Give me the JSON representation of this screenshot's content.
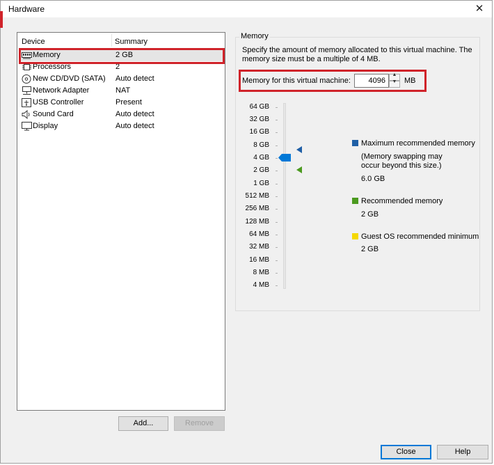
{
  "window": {
    "title": "Hardware",
    "close_glyph": "✕"
  },
  "devices": {
    "col_device": "Device",
    "col_summary": "Summary",
    "items": [
      {
        "name": "Memory",
        "summary": "2 GB",
        "icon": "memory-icon"
      },
      {
        "name": "Processors",
        "summary": "2",
        "icon": "processor-icon"
      },
      {
        "name": "New CD/DVD (SATA)",
        "summary": "Auto detect",
        "icon": "cd-dvd-icon"
      },
      {
        "name": "Network Adapter",
        "summary": "NAT",
        "icon": "network-adapter-icon"
      },
      {
        "name": "USB Controller",
        "summary": "Present",
        "icon": "usb-icon"
      },
      {
        "name": "Sound Card",
        "summary": "Auto detect",
        "icon": "speaker-icon"
      },
      {
        "name": "Display",
        "summary": "Auto detect",
        "icon": "monitor-icon"
      }
    ],
    "selected_index": 0
  },
  "buttons": {
    "add": "Add...",
    "remove": "Remove",
    "close": "Close",
    "help": "Help"
  },
  "memory": {
    "group_title": "Memory",
    "description": "Specify the amount of memory allocated to this virtual machine. The memory size must be a multiple of 4 MB.",
    "field_label": "Memory for this virtual machine:",
    "value": "4096",
    "unit": "MB",
    "scale": [
      "64 GB",
      "32 GB",
      "16 GB",
      "8 GB",
      "4 GB",
      "2 GB",
      "1 GB",
      "512 MB",
      "256 MB",
      "128 MB",
      "64 MB",
      "32 MB",
      "16 MB",
      "8 MB",
      "4 MB"
    ],
    "current": "4 GB",
    "legend": {
      "max_title": "Maximum recommended memory",
      "max_note": "(Memory swapping may occur beyond this size.)",
      "max_value": "6.0 GB",
      "rec_title": "Recommended memory",
      "rec_value": "2 GB",
      "guest_title": "Guest OS recommended minimum",
      "guest_value": "2 GB"
    }
  },
  "colors": {
    "max_marker": "#1f5fa6",
    "recommended_marker": "#4b9a1f",
    "guest_marker": "#f5d800",
    "thumb": "#0078d7",
    "annotation_box": "#d0232a"
  }
}
